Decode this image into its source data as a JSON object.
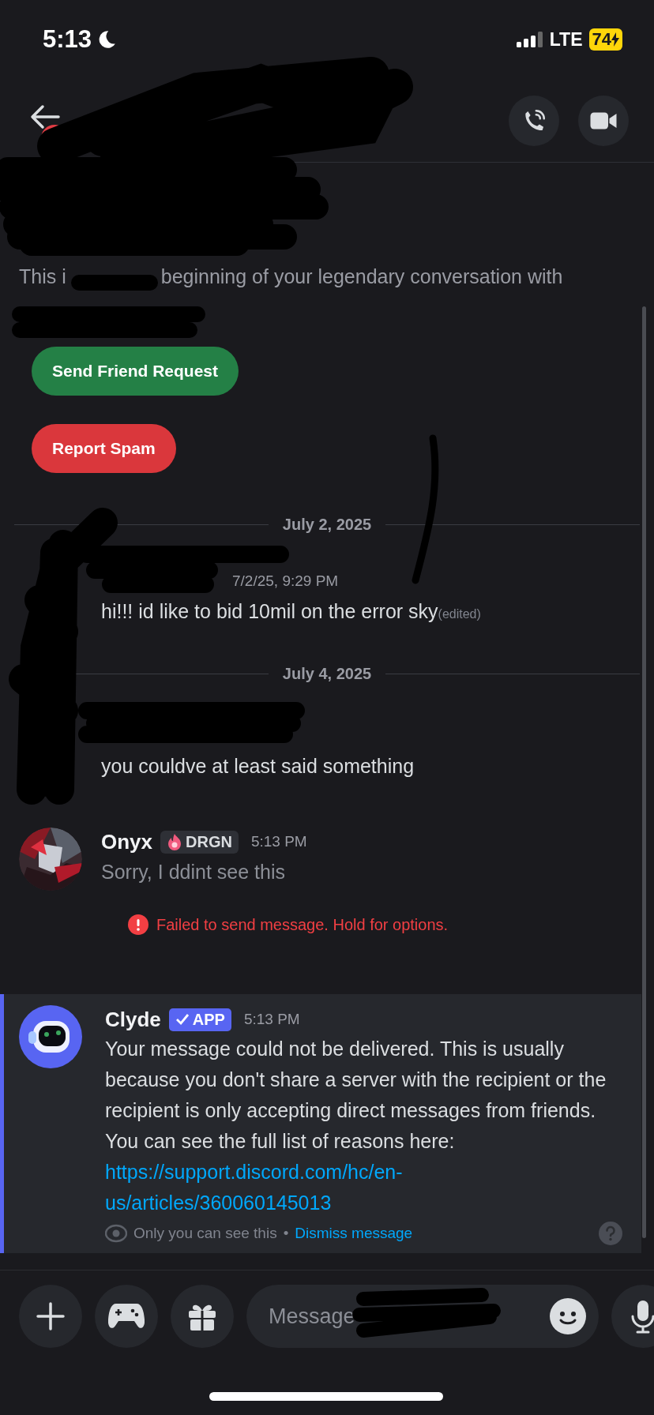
{
  "status_bar": {
    "time": "5:13",
    "network": "LTE",
    "battery": "74"
  },
  "intro": {
    "text_start": "This i",
    "text_end": "beginning of your legendary conversation with"
  },
  "actions": [
    {
      "label": "Send Friend Request",
      "kind": "friend"
    },
    {
      "label": "Report Spam",
      "kind": "spam"
    }
  ],
  "messages": [
    {
      "kind": "divider",
      "date": "July 2, 2025"
    },
    {
      "kind": "message",
      "time": "7/2/25, 9:29 PM",
      "text": "hi!!! id like to bid 10mil on the error sky",
      "edited": "(edited)",
      "failed": false
    },
    {
      "kind": "divider",
      "date": "July 4, 2025"
    },
    {
      "kind": "message",
      "text": "you couldve at least said something",
      "failed": false
    },
    {
      "kind": "message",
      "author": "Onyx",
      "tag": "DRGN",
      "time": "5:13 PM",
      "text": "Sorry, I ddint see this",
      "failed": true,
      "error": "Failed to send message. Hold for options."
    }
  ],
  "system_message": {
    "author": "Clyde",
    "badge": "APP",
    "time": "5:13 PM",
    "text": "Your message could not be delivered. This is usually because you don't share a server with the recipient or the recipient is only accepting direct messages from friends. You can see the full list of reasons here:",
    "link": "https://support.discord.com/hc/en-us/articles/360060145013",
    "note": "Only you can see this",
    "separator": "•",
    "dismiss": "Dismiss message"
  },
  "composer": {
    "placeholder": "Message"
  }
}
